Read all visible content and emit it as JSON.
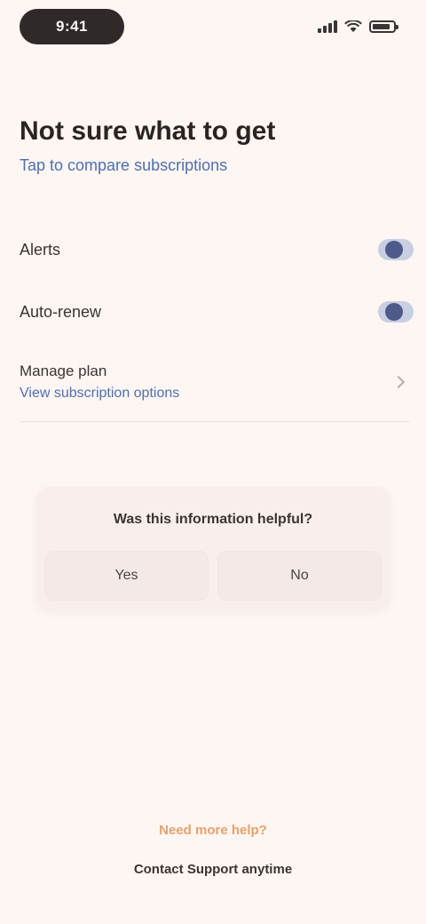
{
  "status_bar": {
    "time": "9:41",
    "icons": [
      "signal-icon",
      "wifi-icon",
      "battery-icon"
    ]
  },
  "header": {
    "title": "Not sure what to get",
    "subtitle": "Tap to compare subscriptions"
  },
  "settings": {
    "items": [
      {
        "label": "Alerts",
        "control": "toggle",
        "enabled": true
      },
      {
        "label": "Auto-renew",
        "control": "toggle",
        "enabled": true
      },
      {
        "label": "Manage plan",
        "link": "View subscription options",
        "control": "chevron"
      }
    ]
  },
  "feedback": {
    "question": "Was this information helpful?",
    "yes_label": "Yes",
    "no_label": "No"
  },
  "footer": {
    "title": "Need more help?",
    "note": "Contact Support anytime"
  },
  "colors": {
    "background": "#fdf6f3",
    "accent_link": "#4f6fb0",
    "toggle_knob": "#4e5a8a",
    "footer_accent": "#e7a06e"
  }
}
